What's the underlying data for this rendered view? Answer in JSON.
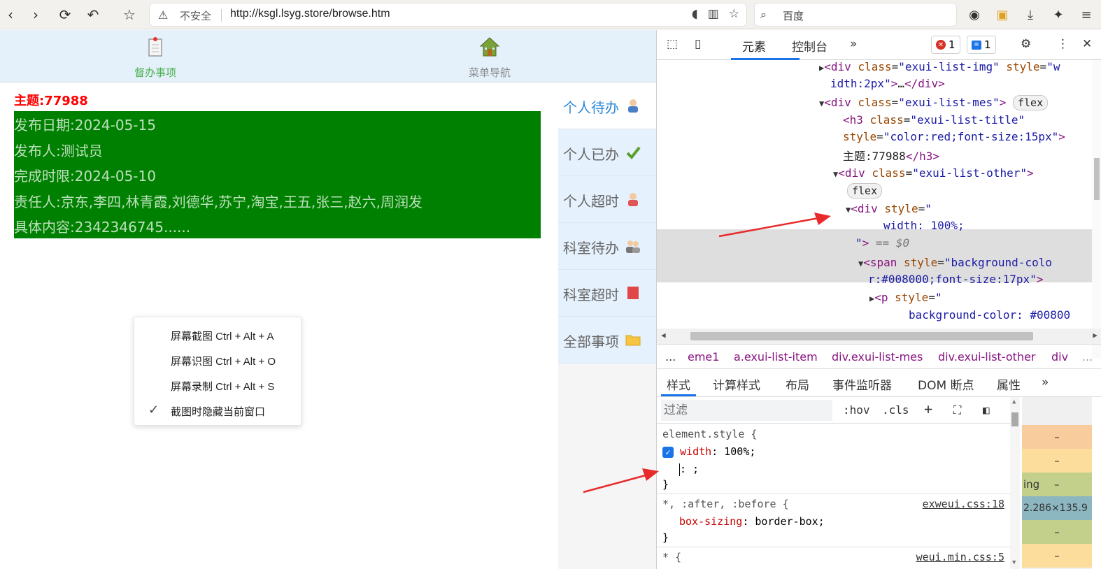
{
  "browser": {
    "insecure_label": "不安全",
    "url": "http://ksgl.lsyg.store/browse.htm",
    "search_placeholder": "百度"
  },
  "page": {
    "tabs": [
      {
        "label": "督办事项",
        "active": true
      },
      {
        "label": "菜单导航",
        "active": false
      }
    ],
    "title": "主题:77988",
    "details": [
      "发布日期:2024-05-15",
      "发布人:测试员",
      "完成时限:2024-05-10",
      "责任人:京东,李四,林青霞,刘德华,苏宁,淘宝,王五,张三,赵六,周润发",
      "具体内容:2342346745......"
    ],
    "side_menu": [
      {
        "label": "个人待办",
        "icon": "person-blue-icon",
        "active": true
      },
      {
        "label": "个人已办",
        "icon": "checkmark-icon",
        "active": false
      },
      {
        "label": "个人超时",
        "icon": "person-red-icon",
        "active": false
      },
      {
        "label": "科室待办",
        "icon": "group-icon",
        "active": false
      },
      {
        "label": "科室超时",
        "icon": "red-square-icon",
        "active": false
      },
      {
        "label": "全部事项",
        "icon": "folder-icon",
        "active": false
      }
    ]
  },
  "context_menu": {
    "items": [
      {
        "label": "屏幕截图 Ctrl + Alt + A",
        "checked": false
      },
      {
        "label": "屏幕识图 Ctrl + Alt + O",
        "checked": false
      },
      {
        "label": "屏幕录制 Ctrl + Alt + S",
        "checked": false
      },
      {
        "label": "截图时隐藏当前窗口",
        "checked": true
      }
    ]
  },
  "devtools": {
    "tabs": [
      "元素",
      "控制台"
    ],
    "error_count": "1",
    "message_count": "1",
    "dom": {
      "l1_tag": "div",
      "l1_attr1": "class",
      "l1_val1": "\"exui-list-img\"",
      "l1_attr2": "style",
      "l1_val2a": "\"w",
      "l2": "idth:2px\"",
      "l3_val": "\"exui-list-mes\"",
      "flex": "flex",
      "l4_val1": "\"exui-list-title\"",
      "l5_val": "\"color:red;font-size:15px\"",
      "l6_text": "主题:77988",
      "l7_val": "\"exui-list-other\"",
      "l9_val": "\"",
      "l10": "width: 100%;",
      "l11_eq": "== $0",
      "l12_val": "\"background-colo",
      "l13": "r:#008000;font-size:17px\"",
      "l14_val": "\"",
      "l15": "background-color: #00800"
    },
    "breadcrumbs": [
      "...",
      "eme1",
      "a.exui-list-item",
      "div.exui-list-mes",
      "div.exui-list-other",
      "div",
      "..."
    ],
    "style_tabs": [
      "样式",
      "计算样式",
      "布局",
      "事件监听器",
      "DOM 断点",
      "属性"
    ],
    "filter_placeholder": "过滤",
    "hov": ":hov",
    "cls": ".cls",
    "styles": {
      "element_selector": "element.style {",
      "prop1": "width",
      "val1": "100%;",
      "edit_line": ": ;",
      "close": "}",
      "rule2_selector": "*, :after, :before {",
      "rule2_src": "exweui.css:18",
      "rule2_prop": "box-sizing",
      "rule2_val": "border-box;",
      "rule3_selector": "* {",
      "rule3_src": "weui.min.css:5"
    },
    "boxmodel": {
      "dash": "–",
      "content_label": "ing",
      "size": "2.286×135.9"
    }
  },
  "colors": {
    "green_box": "#008000",
    "title_red": "#ff0000",
    "active_blue": "#2b88d8",
    "tab_green": "#4caf50"
  }
}
